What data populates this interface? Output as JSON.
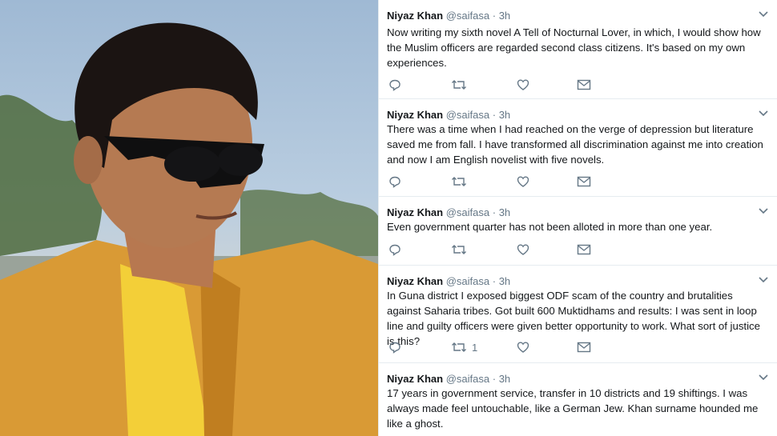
{
  "photo": {
    "alt_subject": "man-wearing-sunglasses-and-yellow-jacket"
  },
  "tweets": [
    {
      "author": "Niyaz Khan",
      "handle": "@saifasa",
      "separator": "·",
      "time": "3h",
      "text": "Now writing my sixth novel A Tell of Nocturnal Lover,  in which, I would  show how the Muslim officers are regarded second class citizens. It's based on my own experiences.",
      "retweet_count": ""
    },
    {
      "author": "Niyaz Khan",
      "handle": "@saifasa",
      "separator": "·",
      "time": "3h",
      "text": "There was a time when I had reached on the verge of depression but literature saved me from fall.  I have transformed all discrimination against me into creation and now I am English novelist with five novels.",
      "retweet_count": ""
    },
    {
      "author": "Niyaz Khan",
      "handle": "@saifasa",
      "separator": "·",
      "time": "3h",
      "text": "Even government quarter has not been alloted in more than one year.",
      "retweet_count": ""
    },
    {
      "author": "Niyaz Khan",
      "handle": "@saifasa",
      "separator": "·",
      "time": "3h",
      "text": "In Guna district I exposed biggest ODF scam of the country and brutalities against Saharia tribes. Got built 600 Muktidhams and results: I was sent in loop line and guilty officers were given better opportunity to work.  What sort of justice is this?",
      "retweet_count": "1"
    },
    {
      "author": "Niyaz Khan",
      "handle": "@saifasa",
      "separator": "·",
      "time": "3h",
      "text": "17 years in government service, transfer  in 10 districts and 19 shiftings.  I was always made feel untouchable, like a German Jew. Khan surname hounded me like a ghost.",
      "retweet_count": ""
    }
  ],
  "icons": {
    "reply": "reply-icon",
    "retweet": "retweet-icon",
    "like": "heart-icon",
    "message": "envelope-icon",
    "menu": "chevron-down-icon"
  },
  "colors": {
    "text": "#14171a",
    "secondary": "#657786",
    "divider": "#e6ecf0"
  }
}
